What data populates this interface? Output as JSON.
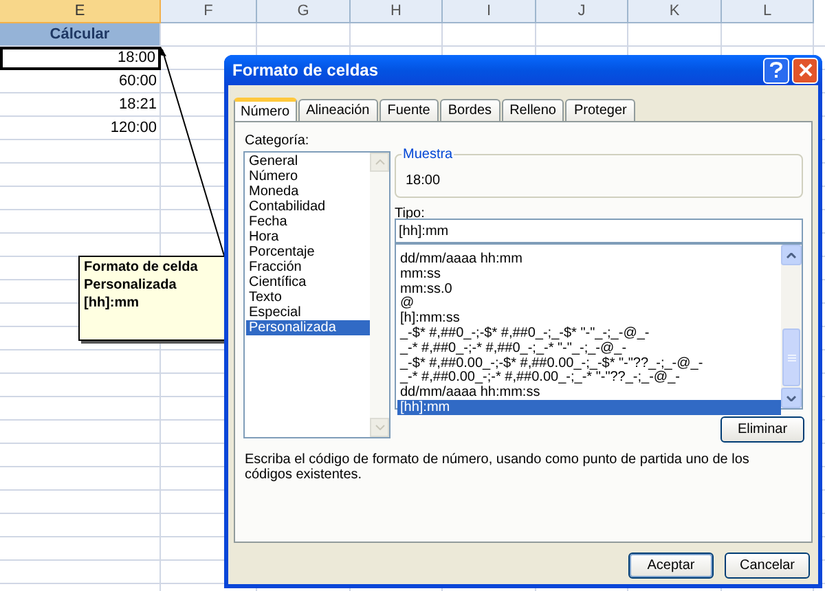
{
  "sheet": {
    "columns": [
      {
        "label": "E",
        "selected": true
      },
      {
        "label": "F",
        "selected": false
      },
      {
        "label": "G",
        "selected": false
      },
      {
        "label": "H",
        "selected": false
      },
      {
        "label": "I",
        "selected": false
      },
      {
        "label": "J",
        "selected": false
      },
      {
        "label": "K",
        "selected": false
      },
      {
        "label": "L",
        "selected": false
      }
    ],
    "header_cell": "Cálcular",
    "cells": [
      {
        "value": "18:00",
        "selected": true
      },
      {
        "value": "60:00",
        "selected": false
      },
      {
        "value": "18:21",
        "selected": false
      },
      {
        "value": "120:00",
        "selected": false
      }
    ]
  },
  "note": {
    "lines": [
      "Formato de celda",
      "Personalizada",
      "[hh]:mm"
    ]
  },
  "dialog": {
    "title": "Formato de celdas",
    "tabs": [
      {
        "label": "Número",
        "selected": true
      },
      {
        "label": "Alineación",
        "selected": false
      },
      {
        "label": "Fuente",
        "selected": false
      },
      {
        "label": "Bordes",
        "selected": false
      },
      {
        "label": "Relleno",
        "selected": false
      },
      {
        "label": "Proteger",
        "selected": false
      }
    ],
    "category_label": "Categoría:",
    "categories": [
      {
        "label": "General",
        "selected": false
      },
      {
        "label": "Número",
        "selected": false
      },
      {
        "label": "Moneda",
        "selected": false
      },
      {
        "label": "Contabilidad",
        "selected": false
      },
      {
        "label": "Fecha",
        "selected": false
      },
      {
        "label": "Hora",
        "selected": false
      },
      {
        "label": "Porcentaje",
        "selected": false
      },
      {
        "label": "Fracción",
        "selected": false
      },
      {
        "label": "Científica",
        "selected": false
      },
      {
        "label": "Texto",
        "selected": false
      },
      {
        "label": "Especial",
        "selected": false
      },
      {
        "label": "Personalizada",
        "selected": true
      }
    ],
    "sample": {
      "legend": "Muestra",
      "value": "18:00"
    },
    "type_label": "Tipo:",
    "type_value": "[hh]:mm",
    "formats": [
      {
        "label": "dd/mm/aaaa hh:mm",
        "selected": false
      },
      {
        "label": "mm:ss",
        "selected": false
      },
      {
        "label": "mm:ss.0",
        "selected": false
      },
      {
        "label": "@",
        "selected": false
      },
      {
        "label": "[h]:mm:ss",
        "selected": false
      },
      {
        "label": "_-$* #,##0_-;-$* #,##0_-;_-$* \"-\"_-;_-@_-",
        "selected": false
      },
      {
        "label": "_-* #,##0_-;-* #,##0_-;_-* \"-\"_-;_-@_-",
        "selected": false
      },
      {
        "label": "_-$* #,##0.00_-;-$* #,##0.00_-;_-$* \"-\"??_-;_-@_-",
        "selected": false
      },
      {
        "label": "_-* #,##0.00_-;-* #,##0.00_-;_-* \"-\"??_-;_-@_-",
        "selected": false
      },
      {
        "label": "dd/mm/aaaa hh:mm:ss",
        "selected": false
      },
      {
        "label": "[hh]:mm",
        "selected": true
      }
    ],
    "delete_button": "Eliminar",
    "description": "Escriba el código de formato de número, usando como punto de partida uno de los códigos existentes.",
    "buttons": [
      "Aceptar",
      "Cancelar"
    ]
  }
}
